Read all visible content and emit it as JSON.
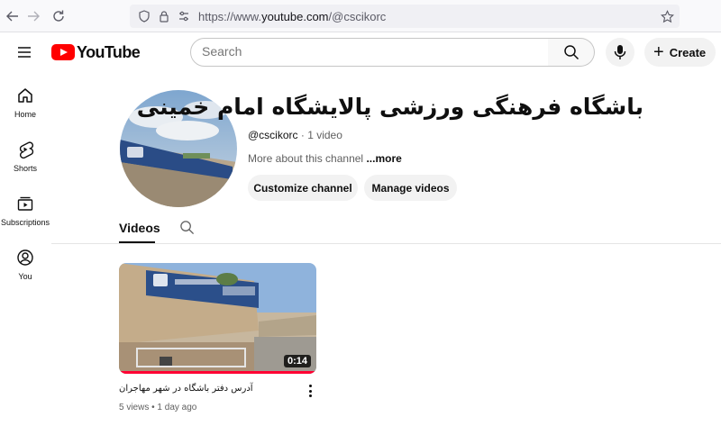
{
  "browser": {
    "url_prefix": "https://www.",
    "url_host": "youtube.com",
    "url_path": "/@cscikorc"
  },
  "header": {
    "logo_text": "YouTube",
    "search_placeholder": "Search",
    "create_label": "Create"
  },
  "sidebar": {
    "items": [
      {
        "label": "Home",
        "icon": "home-icon"
      },
      {
        "label": "Shorts",
        "icon": "shorts-icon"
      },
      {
        "label": "Subscriptions",
        "icon": "subscriptions-icon"
      },
      {
        "label": "You",
        "icon": "you-icon"
      }
    ]
  },
  "channel": {
    "name": "باشگاه فرهنگی ورزشی پالایشگاه امام خمینی",
    "handle": "@cscikorc",
    "separator": " · ",
    "video_count": "1 video",
    "about": "More about this channel",
    "more": "...more",
    "customize_label": "Customize channel",
    "manage_label": "Manage videos"
  },
  "tabs": {
    "videos_label": "Videos"
  },
  "video": {
    "title": "آدرس دفتر باشگاه در شهر مهاجران",
    "duration": "0:14",
    "views": "5 views",
    "dot": " • ",
    "age": "1 day ago",
    "watched_fraction": 1.0
  },
  "colors": {
    "brand_red": "#ff0000",
    "progress_red": "#ff0033",
    "pill_bg": "#f2f2f2"
  }
}
